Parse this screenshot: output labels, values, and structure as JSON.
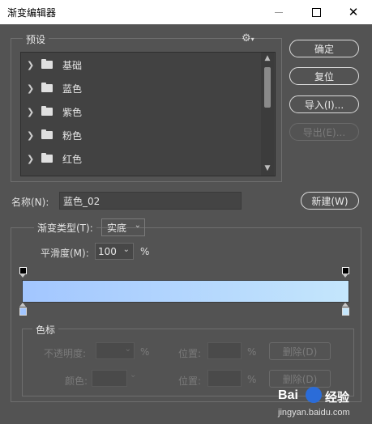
{
  "window": {
    "title": "渐变编辑器"
  },
  "presets": {
    "legend": "预设",
    "items": [
      {
        "label": "基础"
      },
      {
        "label": "蓝色"
      },
      {
        "label": "紫色"
      },
      {
        "label": "粉色"
      },
      {
        "label": "红色"
      }
    ]
  },
  "buttons": {
    "ok": "确定",
    "reset": "复位",
    "import": "导入(I)...",
    "export": "导出(E)...",
    "new": "新建(W)"
  },
  "name": {
    "label": "名称(N):",
    "value": "蓝色_02"
  },
  "gradient": {
    "type_label": "渐变类型(T):",
    "type_value": "实底",
    "smooth_label": "平滑度(M):",
    "smooth_value": "100",
    "smooth_unit": "%",
    "start_color": "#a2c6ff",
    "end_color": "#c4e6fc"
  },
  "color_stops": {
    "legend": "色标",
    "opacity_label": "不透明度:",
    "opacity_unit": "%",
    "position_label_1": "位置:",
    "position_unit_1": "%",
    "delete_1": "删除(D)",
    "color_label": "颜色:",
    "position_label_2": "位置:",
    "position_unit_2": "%",
    "delete_2": "删除(D)"
  },
  "watermark": {
    "brand": "Bai",
    "brand2": "经验",
    "sub": "jingyan.baidu.com"
  },
  "icons": {
    "gear": "gear-icon",
    "folder": "folder-icon",
    "chevron": "chevron-right-icon"
  }
}
